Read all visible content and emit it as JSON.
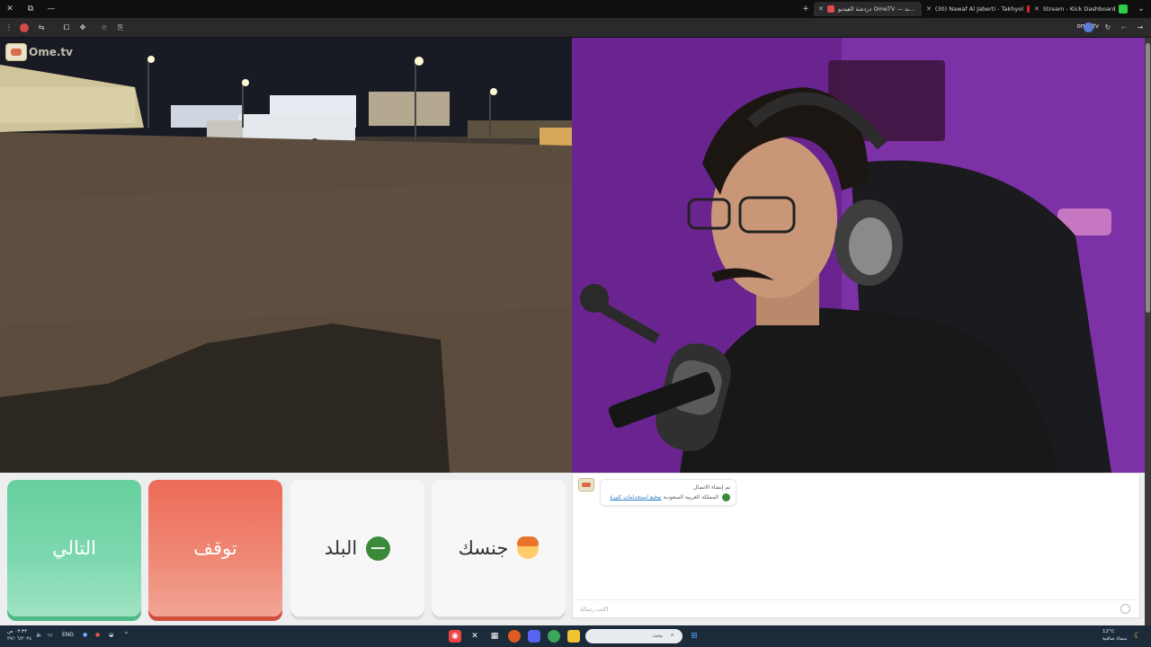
{
  "browser": {
    "tabs": [
      {
        "label": "دردشة الفيديو OmeTV — بد...",
        "active": true
      },
      {
        "label": "(30) Nawaf Al Jaberti - Takhyol",
        "active": false
      },
      {
        "label": "Stream - Kick Dashboard",
        "active": false
      }
    ],
    "url": "ome.tv"
  },
  "site": {
    "logo_text": "Ome.tv"
  },
  "controls": {
    "next_label": "التالي",
    "stop_label": "توقف",
    "country_label": "البلد",
    "gender_label": "جنسك"
  },
  "chat": {
    "system_line1": "تم إنشاء الاتصال",
    "system_country": "المملكة العربية السعودية",
    "system_link": "توقيع استخدامات كثيرة",
    "input_placeholder": "اكتب رسالة"
  },
  "taskbar": {
    "search_placeholder": "بحث",
    "lang": "ENG",
    "weather_temp": "12°C",
    "weather_desc": "سماء صافية",
    "time": "٠٣:٣٣ ص",
    "date": "٢٧/٠٦/٢٠٢٤"
  },
  "colors": {
    "next": "#66cf9d",
    "stop": "#ec6b56",
    "taskbar": "#1c2b3a"
  }
}
